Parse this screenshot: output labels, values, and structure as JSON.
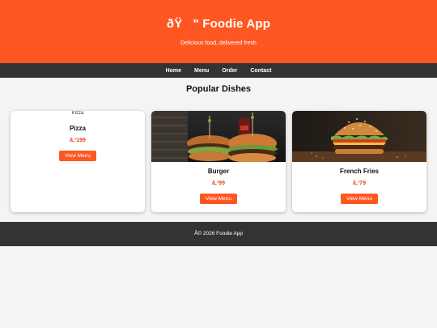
{
  "header": {
    "title": "ðŸ   \" Foodie App",
    "subtitle": "Delicious food, delivered fresh"
  },
  "nav": {
    "items": [
      {
        "label": "Home"
      },
      {
        "label": "Menu"
      },
      {
        "label": "Order"
      },
      {
        "label": "Contact"
      }
    ]
  },
  "section": {
    "title": "Popular Dishes"
  },
  "cards": [
    {
      "name": "Pizza",
      "price": "â‚¹199",
      "button": "View Menu",
      "image_alt": "Pizza"
    },
    {
      "name": "Burger",
      "price": "â‚¹99",
      "button": "View Menu"
    },
    {
      "name": "French Fries",
      "price": "â‚¹79",
      "button": "View Menu"
    }
  ],
  "footer": {
    "text": "Â© 2026 Foodie App"
  },
  "colors": {
    "brand": "#ff5722",
    "nav_bg": "#333333",
    "price": "#e64a19"
  }
}
